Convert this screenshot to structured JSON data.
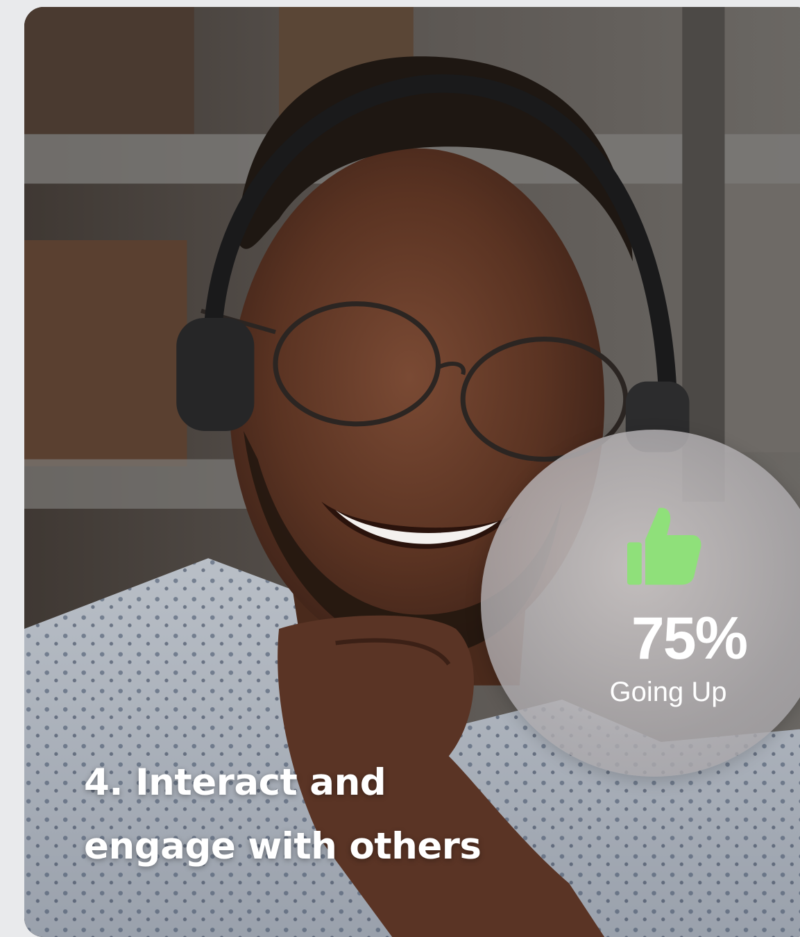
{
  "card": {
    "caption_line1": "4. Interact and",
    "caption_line2": "engage with others"
  },
  "stat": {
    "value": "75%",
    "label": "Going Up",
    "icon": "thumbs-up-icon",
    "icon_color": "#8fe07a"
  }
}
